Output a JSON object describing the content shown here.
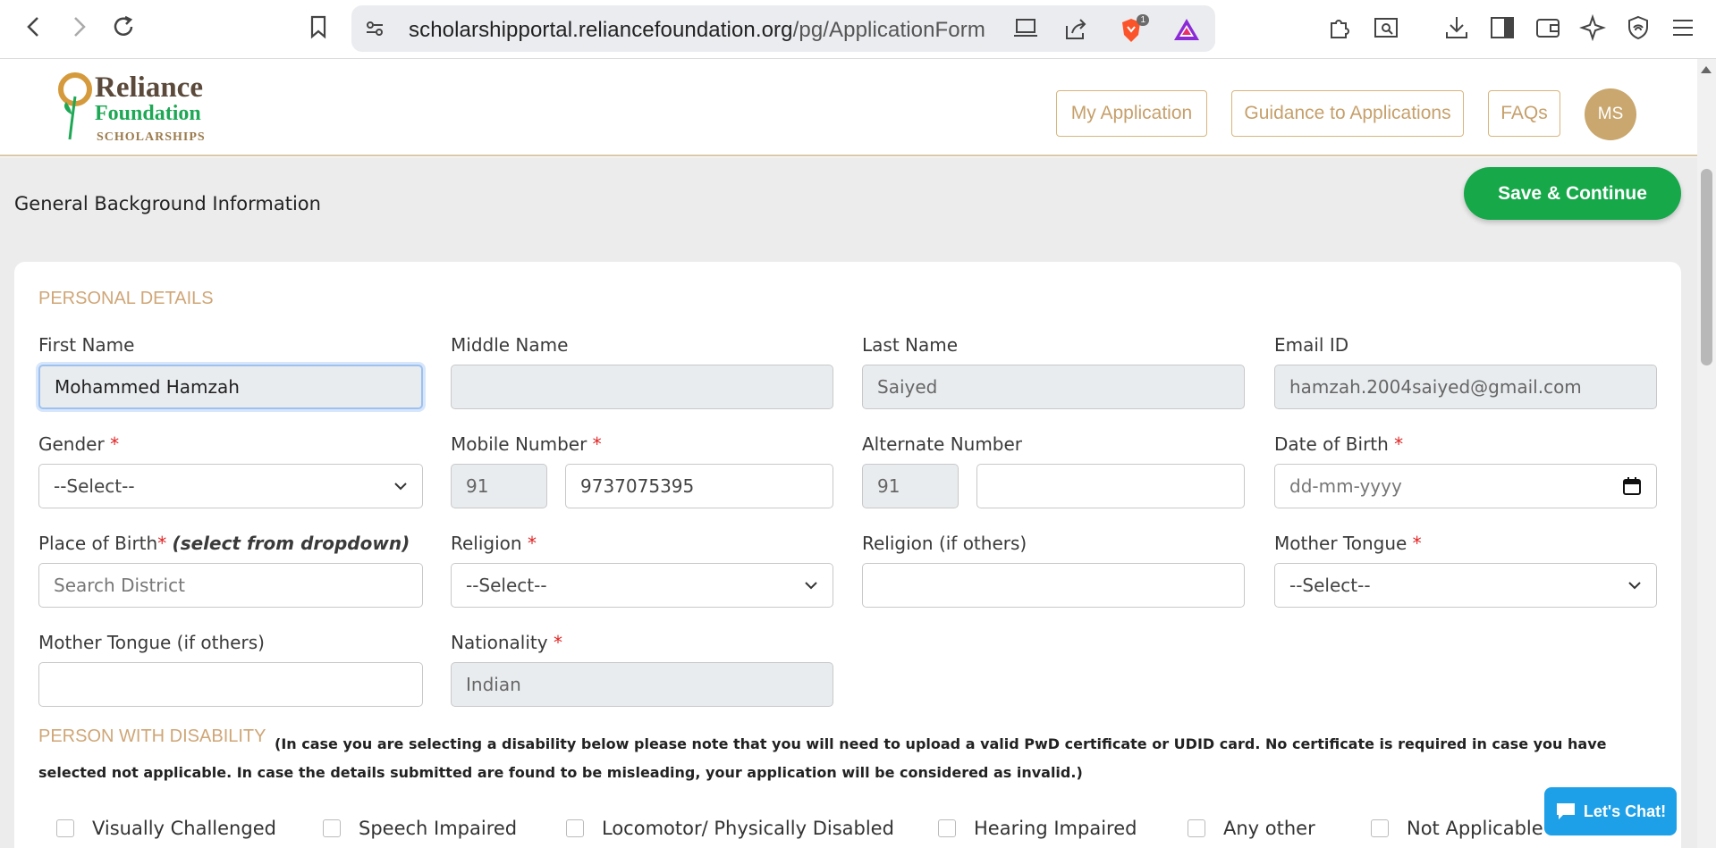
{
  "browser": {
    "url_host": "scholarshipportal.reliancefoundation.org",
    "url_path": "/pg/ApplicationForm",
    "brave_badge": "1"
  },
  "header": {
    "logo": {
      "line1": "Reliance",
      "line2": "Foundation",
      "line3": "SCHOLARSHIPS"
    },
    "my_application": "My Application",
    "guidance": "Guidance to Applications",
    "faqs": "FAQs",
    "avatar_initials": "MS"
  },
  "page": {
    "title": "General Background Information",
    "save_button": "Save & Continue"
  },
  "personal": {
    "heading": "PERSONAL DETAILS",
    "first_name": {
      "label": "First Name",
      "value": "Mohammed Hamzah"
    },
    "middle_name": {
      "label": "Middle Name",
      "value": ""
    },
    "last_name": {
      "label": "Last Name",
      "value": "Saiyed"
    },
    "email": {
      "label": "Email ID",
      "value": "hamzah.2004saiyed@gmail.com"
    },
    "gender": {
      "label": "Gender",
      "value": "--Select--"
    },
    "mobile": {
      "label": "Mobile Number",
      "code": "91",
      "value": "9737075395"
    },
    "alternate": {
      "label": "Alternate Number",
      "code": "91",
      "value": ""
    },
    "dob": {
      "label": "Date of Birth",
      "placeholder": "dd-mm-yyyy"
    },
    "place_of_birth": {
      "label": "Place of Birth",
      "hint": "(select from dropdown)",
      "placeholder": "Search District"
    },
    "religion": {
      "label": "Religion",
      "value": "--Select--"
    },
    "religion_other": {
      "label": "Religion (if others)",
      "value": ""
    },
    "mother_tongue": {
      "label": "Mother Tongue",
      "value": "--Select--"
    },
    "mother_tongue_other": {
      "label": "Mother Tongue (if others)",
      "value": ""
    },
    "nationality": {
      "label": "Nationality",
      "value": "Indian"
    },
    "required_mark": "*"
  },
  "disability": {
    "heading": "PERSON WITH DISABILITY",
    "note": "(In case you are selecting a disability below please note that you will need to upload a valid PwD certificate or UDID card. No certificate is required in case you have selected not applicable. In case the details submitted are found to be misleading, your application will be considered as invalid.)",
    "options": [
      "Visually Challenged",
      "Speech Impaired",
      "Locomotor/ Physically Disabled",
      "Hearing Impaired",
      "Any other",
      "Not Applicable"
    ]
  },
  "chat": {
    "label": "Let's Chat!"
  },
  "colors": {
    "accent_gold": "#c9a76e",
    "save_green": "#17a84a",
    "chat_blue": "#1ea0e8",
    "heading_gold": "#cfa677"
  }
}
